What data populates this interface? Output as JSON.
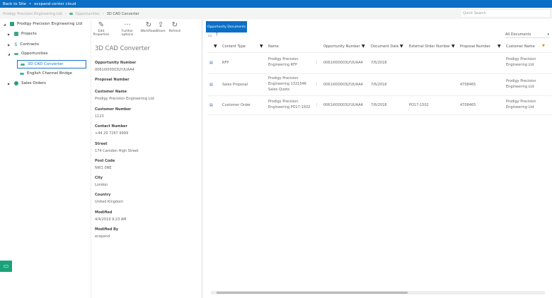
{
  "topbar": {
    "back": "Back to Site",
    "site": "ecspand center cloud"
  },
  "breadcrumb": [
    "Prodigy Precision Engineering Ltd",
    "Opportunities",
    "3D CAD Converter"
  ],
  "search": {
    "placeholder": "Quick Search"
  },
  "tree": {
    "root": "Prodigy Precision Engineering Ltd",
    "projects": "Projects",
    "contracts": "Contracts",
    "opportunities": "Opportunities",
    "opp1": "3D CAD Converter",
    "opp2": "English Channel Bridge",
    "sales": "Sales Orders"
  },
  "toolbar": {
    "edit": "Edit Properties",
    "further": "Further options",
    "workflows": "Workflows",
    "share": "Share",
    "refresh": "Refresh"
  },
  "details": {
    "title": "3D CAD Converter",
    "fields": [
      {
        "label": "Opportunity Number",
        "value": "0061i000003LYUUAA4"
      },
      {
        "label": "Proposal Number",
        "value": ""
      },
      {
        "label": "Customer Name",
        "value": "Prodigy Precision Engineering Ltd"
      },
      {
        "label": "Customer Number",
        "value": "1123"
      },
      {
        "label": "Contact Number",
        "value": "+44 20 7267 9999"
      },
      {
        "label": "Street",
        "value": "174 Camden High Street"
      },
      {
        "label": "Post Code",
        "value": "NW1 0NE"
      },
      {
        "label": "City",
        "value": "London"
      },
      {
        "label": "Country",
        "value": "United Kingdom"
      },
      {
        "label": "Modified",
        "value": "4/4/2019 9:23 AM"
      },
      {
        "label": "Modified By",
        "value": "ecspand"
      }
    ]
  },
  "docs": {
    "tab": "Opportunity Documents",
    "view": "All Documents",
    "columns": [
      "Content Type",
      "Name",
      "Opportunity Number",
      "Document Date",
      "External Order Number",
      "Proposal Number",
      "Customer Name"
    ],
    "rows": [
      [
        "RFP",
        "Prodigy Precision Engineering RFP",
        "0061i000003LYUUAA4",
        "7/6/2018",
        "",
        "",
        "Prodigy Precision Engineering Ltd"
      ],
      [
        "Sales Proposal",
        "Prodigy Precision Engineering 1321546 Sales Quote",
        "0061i000003LYUUAA4",
        "7/6/2018",
        "",
        "4708465",
        "Prodigy Precision Engineering Ltd"
      ],
      [
        "Customer Order",
        "Prodigy Precision Engineering PO17-1502",
        "0061i000003LYUUAA4",
        "7/6/2018",
        "PO17-1502",
        "4708465",
        "Prodigy Precision Engineering Ltd"
      ]
    ]
  }
}
